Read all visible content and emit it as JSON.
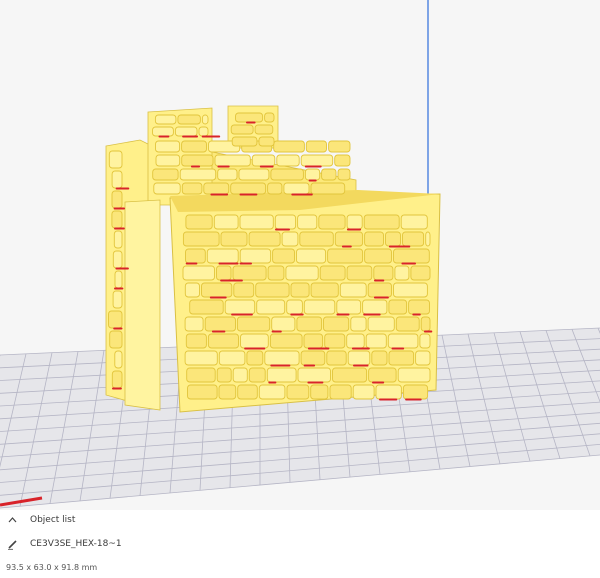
{
  "object_list": {
    "toggle_icon": "chevron-up-icon",
    "title": "Object list",
    "edit_icon": "pencil-icon",
    "object_name": "CE3V3SE_HEX-18~1",
    "dimensions": "93.5 x 63.0 x 91.8 mm"
  },
  "colors": {
    "background": "#f6f6f6",
    "build_plate": "#e6e6ea",
    "grid_lines": "#b5b5c5",
    "axis_line": "#2f6fdc",
    "model_yellow": "#fff08a",
    "model_shadow": "#e2c53c",
    "overhang_red": "#d8232a"
  }
}
